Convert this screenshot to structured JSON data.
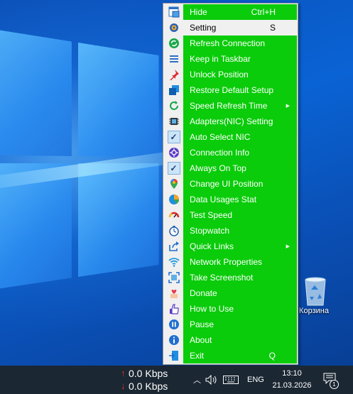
{
  "menu": {
    "items": [
      {
        "label": "Hide",
        "shortcut": "Ctrl+H",
        "icon": "window-hide-icon",
        "submenu": false,
        "checked": false
      },
      {
        "label": "Setting",
        "shortcut": "S",
        "icon": "gear-icon",
        "submenu": false,
        "checked": false
      },
      {
        "label": "Refresh Connection",
        "shortcut": "",
        "icon": "refresh-icon",
        "submenu": false,
        "checked": false
      },
      {
        "label": "Keep in Taskbar",
        "shortcut": "",
        "icon": "taskbar-lines-icon",
        "submenu": false,
        "checked": false
      },
      {
        "label": "Unlock Position",
        "shortcut": "",
        "icon": "pin-icon",
        "submenu": false,
        "checked": false
      },
      {
        "label": "Restore Default Setup",
        "shortcut": "",
        "icon": "restore-icon",
        "submenu": false,
        "checked": false
      },
      {
        "label": "Speed Refresh Time",
        "shortcut": "",
        "icon": "timer-refresh-icon",
        "submenu": true,
        "checked": false
      },
      {
        "label": "Adapters(NIC) Setting",
        "shortcut": "",
        "icon": "network-adapter-icon",
        "submenu": false,
        "checked": false
      },
      {
        "label": "Auto Select NIC",
        "shortcut": "",
        "icon": "checkmark-icon",
        "submenu": false,
        "checked": true
      },
      {
        "label": "Connection Info",
        "shortcut": "",
        "icon": "connection-info-icon",
        "submenu": false,
        "checked": false
      },
      {
        "label": "Always On Top",
        "shortcut": "",
        "icon": "checkmark-icon",
        "submenu": false,
        "checked": true
      },
      {
        "label": "Change UI Position",
        "shortcut": "",
        "icon": "map-pin-icon",
        "submenu": false,
        "checked": false
      },
      {
        "label": "Data Usages Stat",
        "shortcut": "",
        "icon": "pie-chart-icon",
        "submenu": false,
        "checked": false
      },
      {
        "label": "Test Speed",
        "shortcut": "",
        "icon": "speedometer-icon",
        "submenu": false,
        "checked": false
      },
      {
        "label": "Stopwatch",
        "shortcut": "",
        "icon": "stopwatch-icon",
        "submenu": false,
        "checked": false
      },
      {
        "label": "Quick Links",
        "shortcut": "",
        "icon": "share-link-icon",
        "submenu": true,
        "checked": false
      },
      {
        "label": "Network Properties",
        "shortcut": "",
        "icon": "wifi-icon",
        "submenu": false,
        "checked": false
      },
      {
        "label": "Take Screenshot",
        "shortcut": "",
        "icon": "screenshot-icon",
        "submenu": false,
        "checked": false
      },
      {
        "label": "Donate",
        "shortcut": "",
        "icon": "donate-heart-icon",
        "submenu": false,
        "checked": false
      },
      {
        "label": "How to Use",
        "shortcut": "",
        "icon": "pointing-hand-icon",
        "submenu": false,
        "checked": false
      },
      {
        "label": "Pause",
        "shortcut": "",
        "icon": "pause-icon",
        "submenu": false,
        "checked": false
      },
      {
        "label": "About",
        "shortcut": "",
        "icon": "info-icon",
        "submenu": false,
        "checked": false
      },
      {
        "label": "Exit",
        "shortcut": "Q",
        "icon": "exit-door-icon",
        "submenu": false,
        "checked": false
      }
    ],
    "highlighted_index": 1,
    "colors": {
      "background": "#0acc0a",
      "text": "#ffffff",
      "highlight": "#f0f0f0"
    }
  },
  "desktop": {
    "recycle_bin_label": "Корзина"
  },
  "taskbar": {
    "upload_speed": "0.0 Kbps",
    "download_speed": "0.0 Kbps",
    "language": "ENG",
    "time": "13:10",
    "date": "21.03.2026",
    "notification_count": "1"
  }
}
